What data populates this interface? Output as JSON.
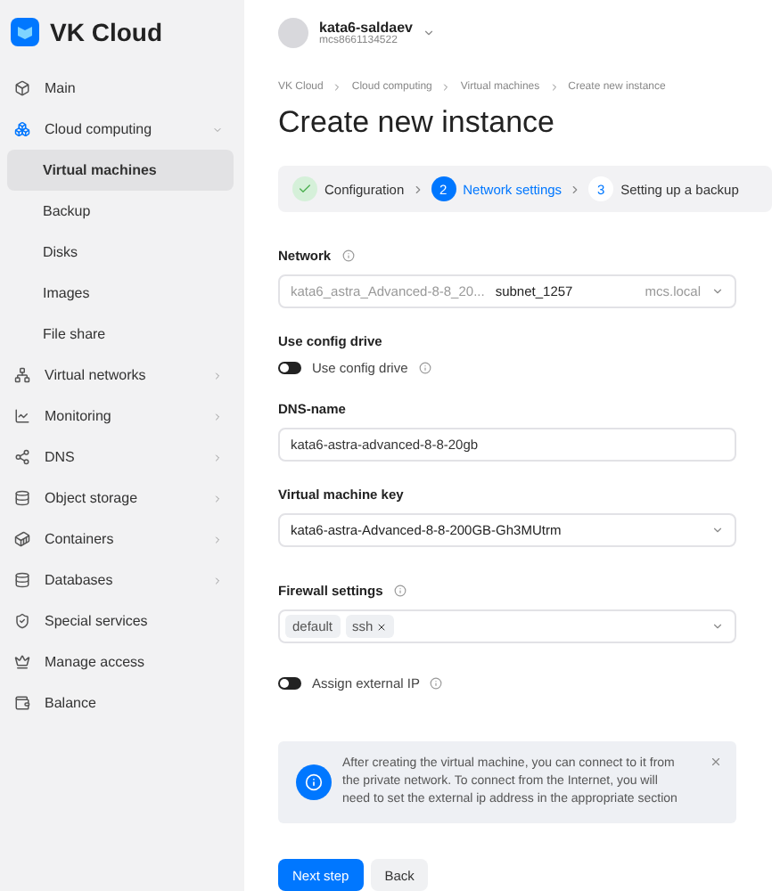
{
  "sidebar": {
    "logo": "VK Cloud",
    "items": [
      {
        "label": "Main",
        "selected": false
      },
      {
        "label": "Cloud computing",
        "selected": false,
        "expanded": true,
        "children": [
          {
            "label": "Virtual machines",
            "selected": true
          },
          {
            "label": "Backup",
            "selected": false
          },
          {
            "label": "Disks",
            "selected": false
          },
          {
            "label": "Images",
            "selected": false
          },
          {
            "label": "File share",
            "selected": false
          }
        ]
      },
      {
        "label": "Virtual networks",
        "selected": false,
        "expanded": false
      },
      {
        "label": "Monitoring",
        "selected": false,
        "expanded": false
      },
      {
        "label": "DNS",
        "selected": false,
        "expanded": false
      },
      {
        "label": "Object storage",
        "selected": false,
        "expanded": false
      },
      {
        "label": "Containers",
        "selected": false,
        "expanded": false
      },
      {
        "label": "Databases",
        "selected": false,
        "expanded": false
      },
      {
        "label": "Special services",
        "selected": false
      },
      {
        "label": "Manage access",
        "selected": false
      },
      {
        "label": "Balance",
        "selected": false
      }
    ]
  },
  "account": {
    "name": "kata6-saldaev",
    "id": "mcs8661134522"
  },
  "breadcrumbs": [
    "VK Cloud",
    "Cloud computing",
    "Virtual machines",
    "Create new instance"
  ],
  "title": "Create new instance",
  "steps": [
    {
      "label": "Configuration",
      "completed": true,
      "selected": false
    },
    {
      "number": "2",
      "label": "Network settings",
      "completed": false,
      "selected": true
    },
    {
      "number": "3",
      "label": "Setting up a backup",
      "completed": false,
      "selected": false
    }
  ],
  "network": {
    "label": "Network",
    "value": "kata6_astra_Advanced-8-8_20...",
    "subnet": "subnet_1257",
    "domain": "mcs.local"
  },
  "config_drive": {
    "label": "Use config drive",
    "toggle_label": "Use config drive",
    "on": false
  },
  "dns_name": {
    "label": "DNS-name",
    "value": "kata6-astra-advanced-8-8-20gb"
  },
  "vm_key": {
    "label": "Virtual machine key",
    "value": "kata6-astra-Advanced-8-8-200GB-Gh3MUtrm"
  },
  "firewall": {
    "label": "Firewall settings",
    "tags": [
      {
        "label": "default",
        "removable": false
      },
      {
        "label": "ssh",
        "removable": true
      }
    ]
  },
  "external_ip": {
    "label": "Assign external IP",
    "on": false
  },
  "notice": "After creating the virtual machine, you can connect to it from the private network. To connect from the Internet, you will need to set the external ip address in the appropriate section",
  "buttons": [
    {
      "label": "Next step",
      "kind": "primary"
    },
    {
      "label": "Back",
      "kind": "secondary"
    }
  ]
}
